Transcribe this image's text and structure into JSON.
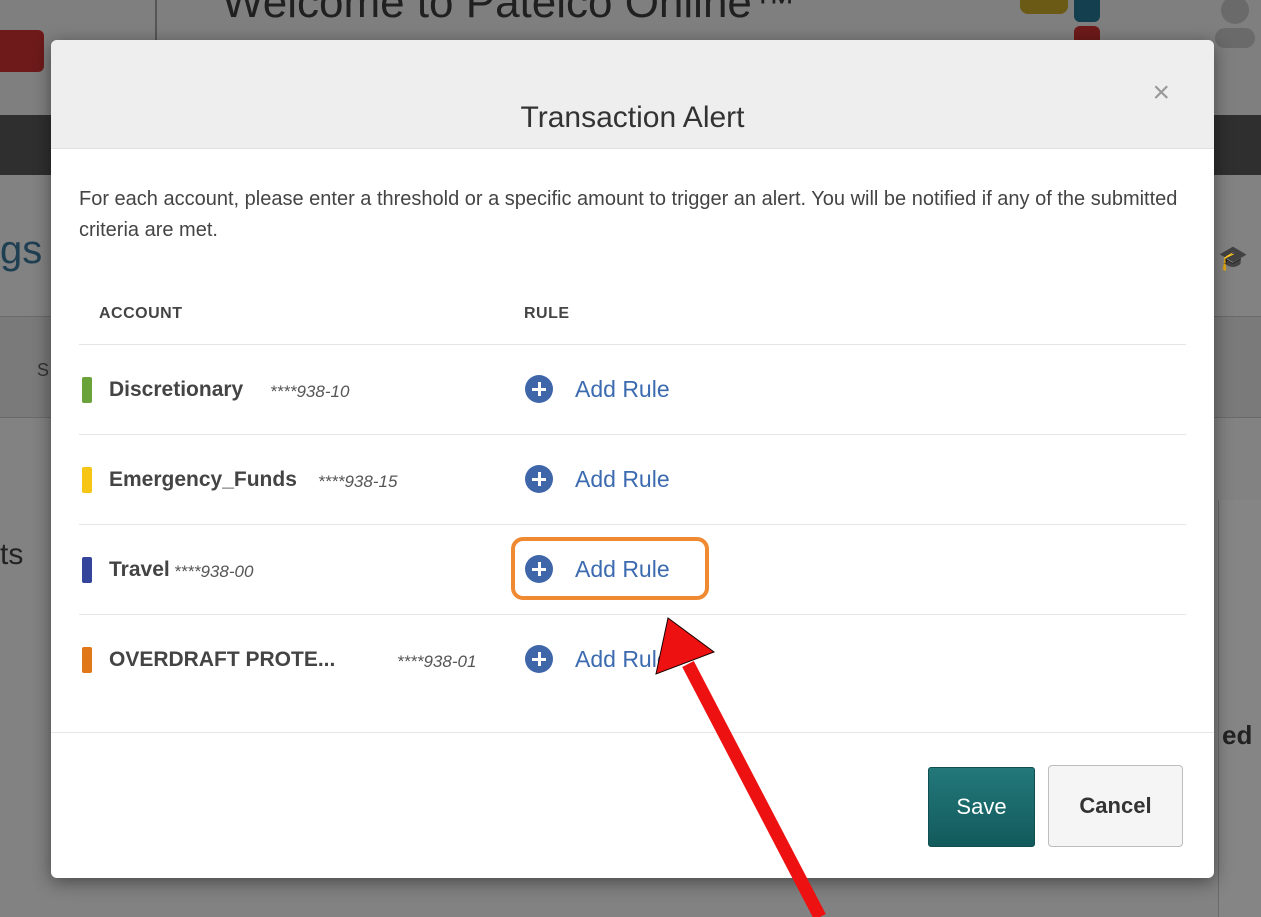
{
  "background": {
    "welcome_text": "Welcome to Patelco Online™",
    "partial_title": "gs",
    "partial_strip_letter": "S",
    "partial_side_text": "ts",
    "partial_right_text": "ed"
  },
  "modal": {
    "title": "Transaction Alert",
    "close_label": "×",
    "intro": "For each account, please enter a threshold or a specific amount to trigger an alert. You will be notified if any of the submitted criteria are met.",
    "columns": {
      "account": "ACCOUNT",
      "rule": "RULE"
    },
    "accounts": [
      {
        "name": "Discretionary",
        "number": "****938-10",
        "color": "#6aa33a",
        "rule_label": "Add Rule"
      },
      {
        "name": "Emergency_Funds",
        "number": "****938-15",
        "color": "#f7c615",
        "rule_label": "Add Rule"
      },
      {
        "name": "Travel",
        "number": "****938-00",
        "color": "#34449a",
        "rule_label": "Add Rule"
      },
      {
        "name": "OVERDRAFT PROTE...",
        "number": "****938-01",
        "color": "#e0781a",
        "rule_label": "Add Rule"
      }
    ],
    "save_label": "Save",
    "cancel_label": "Cancel"
  },
  "colors": {
    "accent": "#3e66a8",
    "save_button": "#1a6b6d",
    "highlight": "#f08a32",
    "arrow": "#ee1111"
  }
}
